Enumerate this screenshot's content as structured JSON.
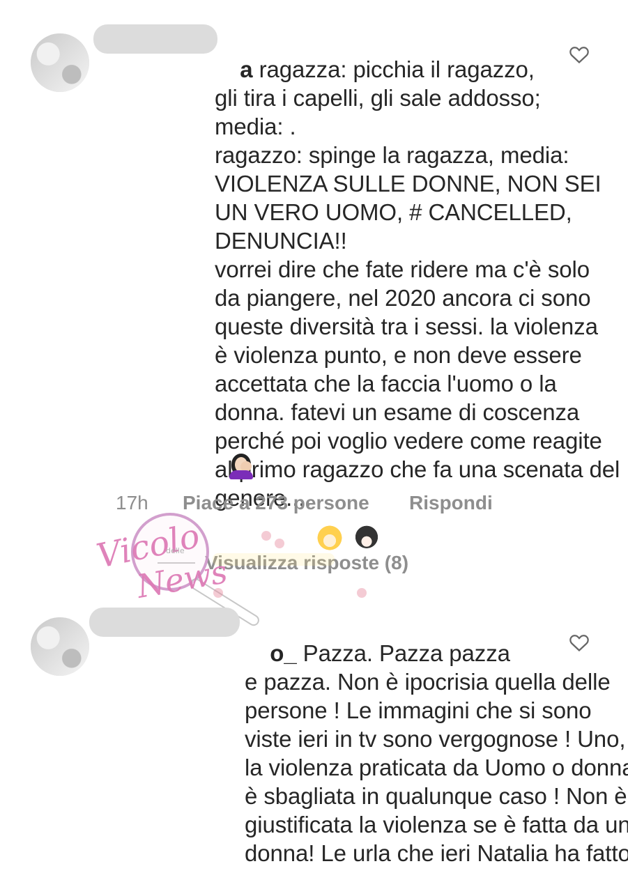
{
  "comment1": {
    "username_visible": "a",
    "body": " ragazza: picchia il ragazzo,\ngli tira i capelli, gli sale addosso;\nmedia: .\nragazzo: spinge la ragazza, media:\nVIOLENZA SULLE DONNE, NON SEI\nUN VERO UOMO, # CANCELLED,\nDENUNCIA!!\nvorrei dire che fate ridere ma c'è solo\nda piangere, nel 2020 ancora ci sono\nqueste diversità tra i sessi. la violenza\nè violenza punto, e non deve essere\naccettata che la faccia l'uomo o la\ndonna. fatevi un esame di coscenza\nperché poi voglio vedere come reagite\nal primo ragazzo che fa una scenata del\ngenere....",
    "time": "17h",
    "likes": "Piace a 273 persone",
    "reply": "Rispondi",
    "view_replies": "Visualizza risposte (8)",
    "like_icon": "heart-icon",
    "emoji_icon": "woman-facepalming-icon"
  },
  "comment2": {
    "username_visible": "o_",
    "body": " Pazza. Pazza pazza\ne pazza. Non è ipocrisia quella delle\npersone ! Le immagini che si sono\nviste ieri in tv sono vergognose ! Uno,\nla violenza praticata da Uomo o donna\nè sbagliata in qualunque caso ! Non è\ngiustificata la violenza se è fatta da una\ndonna! Le urla che ieri Natalia ha fatto,",
    "like_icon": "heart-icon"
  },
  "watermark": {
    "script_a": "Vicolo",
    "small": "delle",
    "script_b": "News"
  },
  "colors": {
    "text": "#262626",
    "muted": "#8e8e8e",
    "background": "#ffffff",
    "watermark_pink": "#dc78b4"
  }
}
